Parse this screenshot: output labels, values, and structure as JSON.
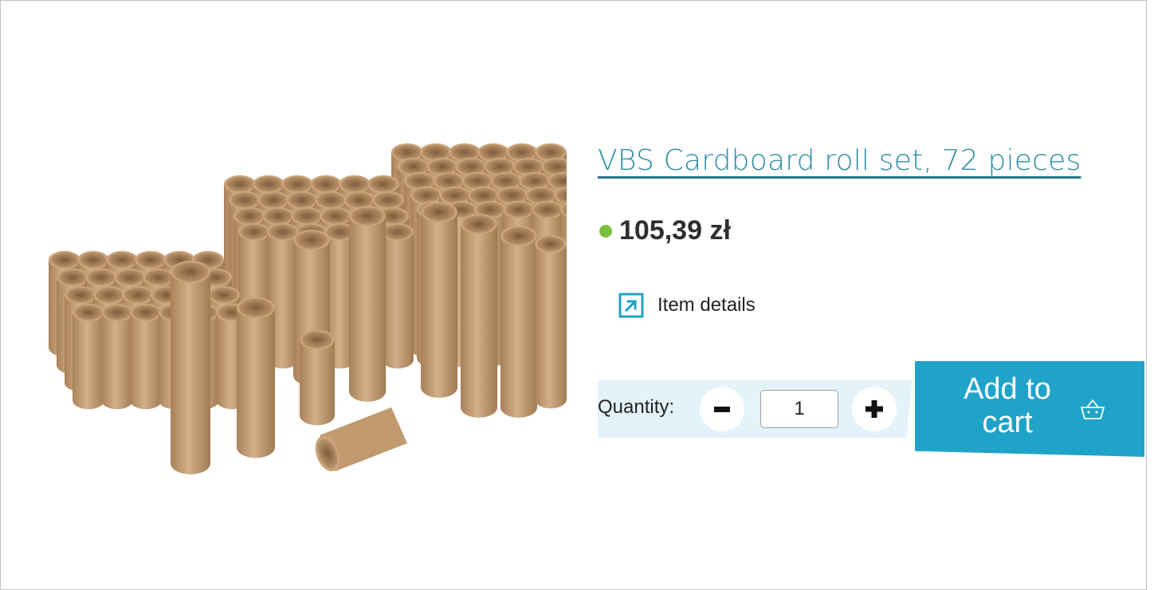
{
  "product": {
    "title": "VBS Cardboard roll set, 72 pieces",
    "price": "105,39 zł",
    "image_icon": "cardboard-rolls-image"
  },
  "details": {
    "label": "Item details",
    "icon": "external-link-icon"
  },
  "quantity": {
    "label": "Quantity:",
    "value": "1",
    "minus_icon": "minus-icon",
    "plus_icon": "plus-icon"
  },
  "cart": {
    "label": "Add to cart",
    "icon": "basket-icon"
  },
  "colors": {
    "accent": "#1fa3c9",
    "title": "#2e8fa8",
    "in_stock": "#7cbf3f",
    "quantity_band": "#e4f3f9"
  }
}
